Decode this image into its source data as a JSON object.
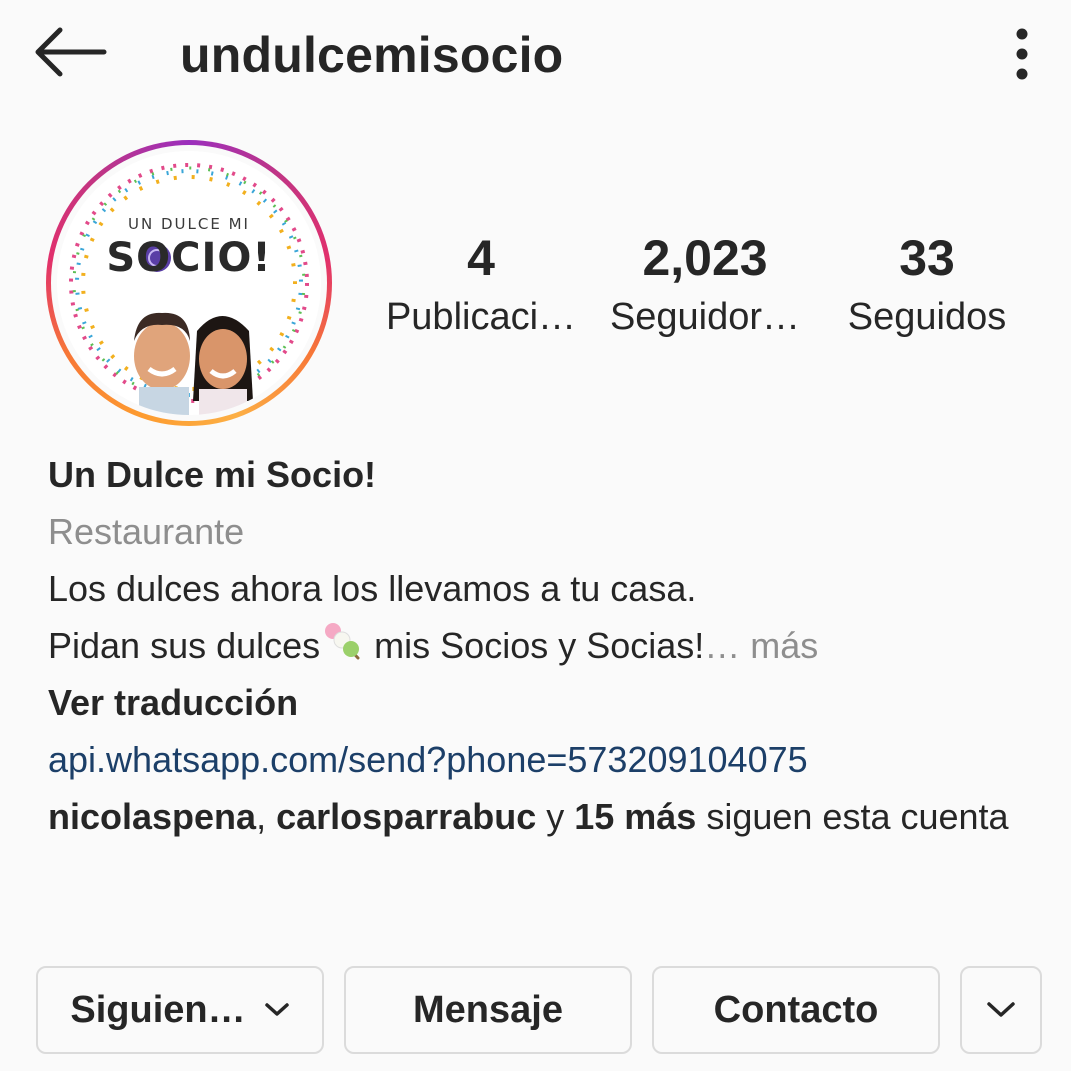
{
  "header": {
    "back_icon": "arrow-left-icon",
    "username": "undulcemisocio",
    "menu_icon": "more-vertical-icon"
  },
  "avatar": {
    "logo_small": "UN DULCE MI",
    "logo_big": "SOCIO!",
    "ring_colors": [
      "#fd9b2f",
      "#e1306c",
      "#c13584"
    ]
  },
  "stats": {
    "posts": {
      "value": "4",
      "label": "Publicaci…"
    },
    "followers": {
      "value": "2,023",
      "label": "Seguidor…"
    },
    "following": {
      "value": "33",
      "label": "Seguidos"
    }
  },
  "bio": {
    "name": "Un Dulce mi Socio!",
    "category": "Restaurante",
    "line1": "Los dulces ahora los llevamos a tu casa.",
    "line2_before": "Pidan sus dulces",
    "line2_after": " mis Socios y Socias!",
    "more": "… más",
    "translate": "Ver traducción",
    "link": "api.whatsapp.com/send?phone=573209104075",
    "followed_by": {
      "user1": "nicolaspena",
      "sep": ", ",
      "user2": "carlosparrabuc",
      "and": " y ",
      "others": "15 más",
      "suffix": " siguen esta cuenta"
    }
  },
  "buttons": {
    "following": "Siguien…",
    "message": "Mensaje",
    "contact": "Contacto",
    "more_icon": "chevron-down-icon"
  },
  "colors": {
    "link": "#1c3f68",
    "secondary_text": "#8e8e8e",
    "background": "#fafafa",
    "border": "#dbdbdb"
  }
}
